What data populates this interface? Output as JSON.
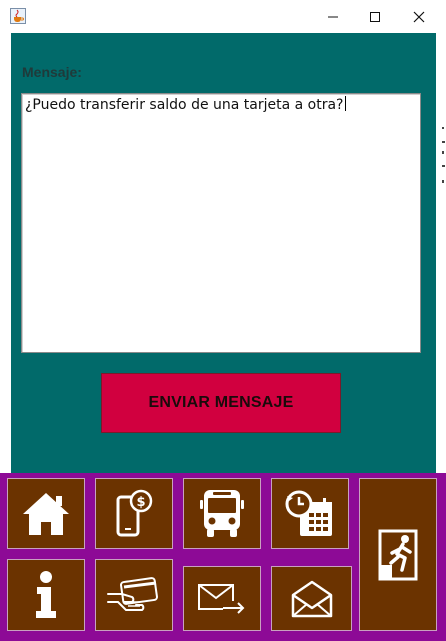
{
  "window": {
    "controls": {
      "minimize": "—",
      "maximize": "☐",
      "close": "✕"
    },
    "app_icon": "java-cup-icon"
  },
  "message": {
    "label": "Mensaje:",
    "text": "¿Puedo transferir saldo de una tarjeta a otra?"
  },
  "send_button": {
    "label": "ENVIAR MENSAJE"
  },
  "colors": {
    "panel": "#016a6a",
    "send_button": "#d1003f",
    "nav_background": "#8d0a96",
    "nav_button": "#6b3300",
    "icon": "#ffffff"
  },
  "nav": {
    "icons": [
      "home-icon",
      "mobile-payment-icon",
      "bus-icon",
      "schedule-calendar-icon",
      "exit-icon",
      "info-icon",
      "card-payment-icon",
      "send-mail-icon",
      "open-mail-icon"
    ]
  }
}
